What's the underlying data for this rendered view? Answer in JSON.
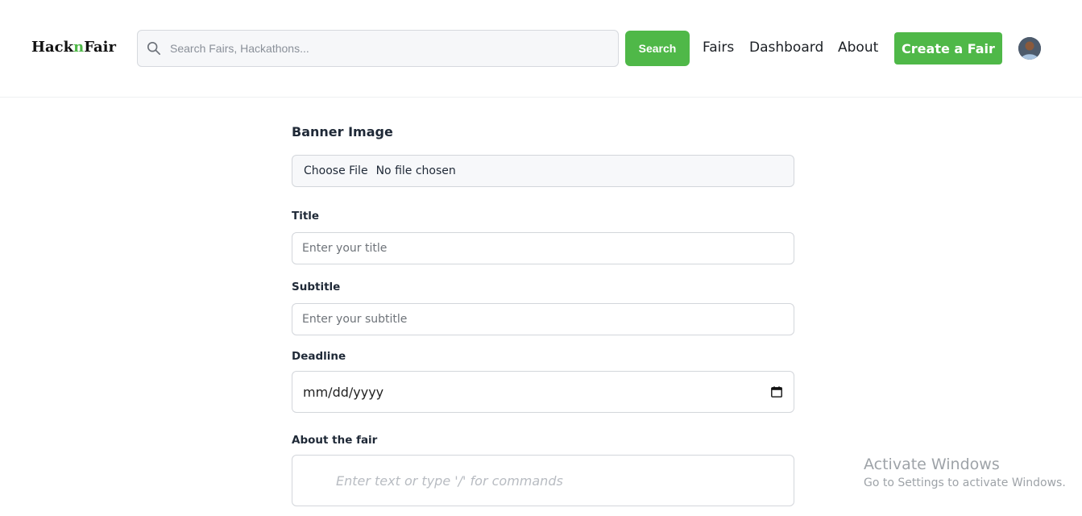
{
  "header": {
    "logo_part1": "Hack",
    "logo_part2": "n",
    "logo_part3": "Fair",
    "search_placeholder": "Search Fairs, Hackathons...",
    "search_button": "Search",
    "nav": [
      "Fairs",
      "Dashboard",
      "About"
    ],
    "create_button": "Create a Fair",
    "accent_color": "#4fb848"
  },
  "form": {
    "banner_label": "Banner Image",
    "file_button": "Choose File",
    "file_status": "No file chosen",
    "title_label": "Title",
    "title_placeholder": "Enter your title",
    "subtitle_label": "Subtitle",
    "subtitle_placeholder": "Enter your subtitle",
    "deadline_label": "Deadline",
    "deadline_placeholder": "mm/dd/yyyy",
    "about_label": "About the fair",
    "about_placeholder": "Enter text or type '/' for commands"
  },
  "watermark": {
    "line1": "Activate Windows",
    "line2": "Go to Settings to activate Windows."
  }
}
